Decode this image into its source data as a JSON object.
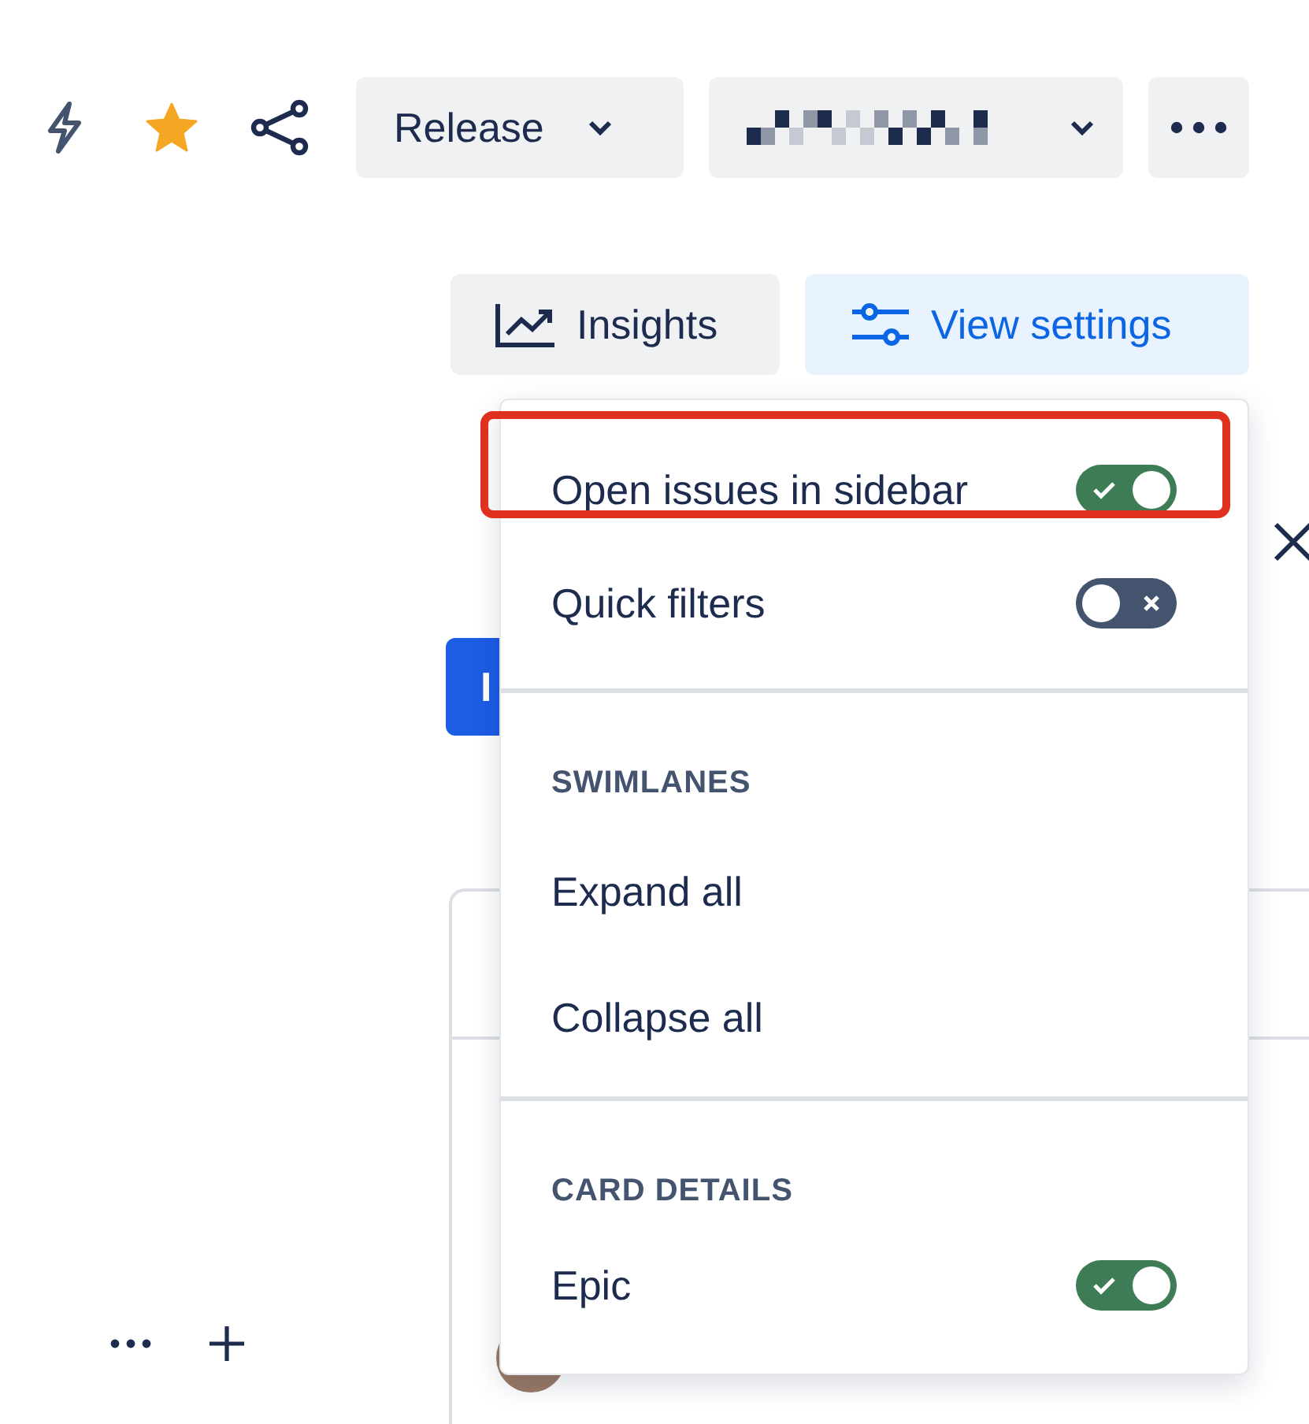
{
  "toolbar": {
    "release_button": {
      "label": "Release"
    }
  },
  "view_bar": {
    "insights_button": {
      "label": "Insights"
    },
    "view_settings_button": {
      "label": "View settings",
      "selected": true
    }
  },
  "background": {
    "button_label": "I"
  },
  "menu": {
    "items": [
      {
        "kind": "toggle",
        "label": "Open issues in sidebar",
        "on": true,
        "annotated": true
      },
      {
        "kind": "toggle",
        "label": "Quick filters",
        "on": false,
        "annotated": false
      },
      {
        "kind": "divider"
      },
      {
        "kind": "heading",
        "label": "SWIMLANES"
      },
      {
        "kind": "action",
        "label": "Expand all"
      },
      {
        "kind": "action",
        "label": "Collapse all"
      },
      {
        "kind": "divider"
      },
      {
        "kind": "heading",
        "label": "CARD DETAILS"
      },
      {
        "kind": "toggle",
        "label": "Epic",
        "on": true,
        "annotated": false
      }
    ]
  }
}
